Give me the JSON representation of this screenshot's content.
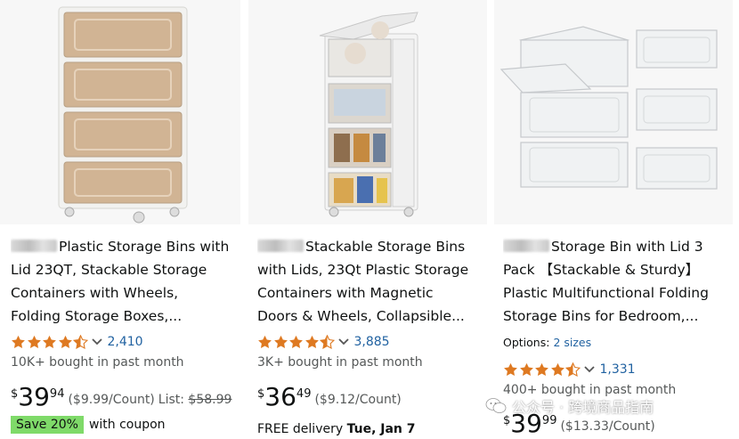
{
  "products": [
    {
      "title_suffix": "Plastic Storage Bins with",
      "title_lines": [
        "Lid 23QT, Stackable Storage",
        "Containers with Wheels,",
        "Folding Storage Boxes,..."
      ],
      "rating": 4.5,
      "rating_count": "2,410",
      "bought": "10K+ bought in past month",
      "price_symbol": "$",
      "price_whole": "39",
      "price_fraction": "94",
      "per_unit": "($9.99/Count)",
      "list_label": "List:",
      "list_price": "$58.99",
      "coupon_badge": "Save 20%",
      "coupon_text": "with coupon"
    },
    {
      "title_suffix": "Stackable Storage Bins",
      "title_lines": [
        "with Lids, 23Qt Plastic Storage",
        "Containers with Magnetic",
        "Doors & Wheels, Collapsible..."
      ],
      "rating": 4.5,
      "rating_count": "3,885",
      "bought": "3K+ bought in past month",
      "price_symbol": "$",
      "price_whole": "36",
      "price_fraction": "49",
      "per_unit": "($9.12/Count)",
      "delivery_prefix": "FREE delivery",
      "delivery_date": "Tue, Jan 7"
    },
    {
      "title_suffix": "Storage Bin with Lid 3",
      "title_lines": [
        "Pack 【Stackable & Sturdy】",
        "Plastic Multifunctional Folding",
        "Storage Bins for Bedroom,..."
      ],
      "options_label": "Options:",
      "options_link": "2 sizes",
      "rating": 4.5,
      "rating_count": "1,331",
      "bought": "400+ bought in past month",
      "price_symbol": "$",
      "price_whole": "39",
      "price_fraction": "99",
      "per_unit": "($13.33/Count)"
    }
  ],
  "watermark": "公众号 · 跨境商品指南",
  "colors": {
    "star": "#de7921",
    "link": "#2162a1",
    "badge": "#7fda69",
    "muted": "#565959"
  }
}
